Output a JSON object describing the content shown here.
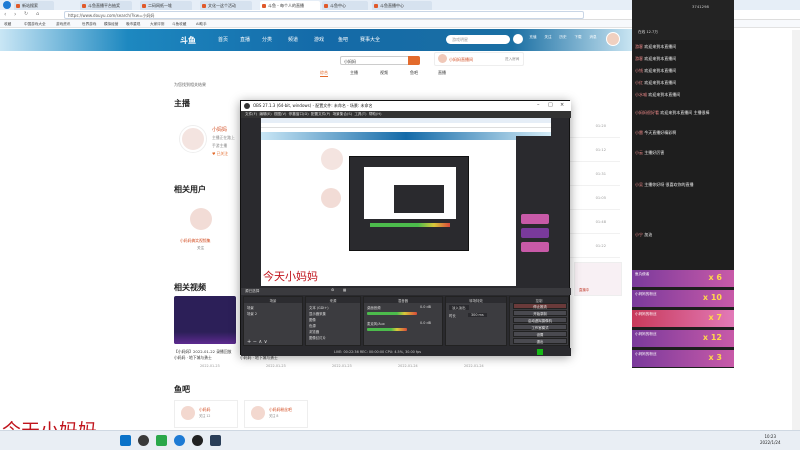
{
  "browser": {
    "tabs": [
      "新站搜索",
      "斗鱼直播平台抽奖",
      "二码网纸一堆",
      "文化—这个活动",
      "斗鱼 - 每个人的直播",
      "斗鱼中心",
      "斗鱼直播中心"
    ],
    "url": "https://www.douyu.com/search/?kw=小妈妈",
    "bookmarks": [
      "收藏",
      "中国游戏大全",
      "游戏资讯",
      "世界游戏",
      "模拟经营",
      "晚市重现",
      "大家评测",
      "斗鱼收藏",
      "AI助手"
    ]
  },
  "site": {
    "logo": "斗鱼",
    "nav": [
      "首页",
      "直播",
      "分类",
      "频道",
      "游戏",
      "鱼吧",
      "赛事大全"
    ],
    "search_placeholder": "游戏明星",
    "header_icons": [
      "充值",
      "关注",
      "历史",
      "下载",
      "消息"
    ],
    "query": "小妈妈",
    "search_tabs": [
      "综合",
      "主播",
      "视频",
      "鱼吧",
      "直播"
    ],
    "room_name": "小妈妈直播间",
    "room_enter": "进入房间",
    "breadcrumb": "为您找到相关结果",
    "sections": {
      "anchor": "主播",
      "users": "相关用户",
      "videos": "相关视频",
      "fish": "鱼吧"
    },
    "anchor": {
      "name": "小妈妈",
      "sub1": "主播正在路上",
      "sub2": "手游主播",
      "follow": "♥ 已关注"
    },
    "user": {
      "name": "小妈妈搞笑视频集",
      "follow": "关注"
    },
    "videos": [
      {
        "title": "【小妈妈】2022-01-22 录播回放",
        "meta": "小妈妈 · 地下城与勇士",
        "date": "2022-01-23"
      },
      {
        "title": "小妈妈勇士赛事",
        "meta": "小妈妈 · 地下城与勇士",
        "date": "2022-01-23"
      },
      {
        "title": "小妈妈直播精彩",
        "meta": "小妈妈 · 地下城与勇士",
        "date": "2022-01-23"
      },
      {
        "title": "小妈妈通关集锦",
        "meta": "小妈妈 · 地下城与勇士",
        "date": "2022-01-24"
      },
      {
        "title": "小妈妈直播回放",
        "meta": "小妈妈 · 地下城与勇士",
        "date": "2022-01-24"
      }
    ],
    "fish": [
      {
        "name": "小妈妈",
        "sub": "关注 12"
      },
      {
        "name": "小妈妈粉丝吧",
        "sub": "关注 8"
      }
    ],
    "side_times": [
      "01:20",
      "01:12",
      "01:31",
      "01:05",
      "01:48",
      "01:22"
    ],
    "right_cards": [
      "直播中",
      "直播中",
      "直播中",
      "直播中"
    ]
  },
  "obs": {
    "title": "OBS 27.1.3 (64-bit, windows) - 配置文件: 未命名 - 场景: 未命名",
    "menu": [
      "文件(F)",
      "编辑(E)",
      "视图(V)",
      "停靠窗口(D)",
      "配置文件(P)",
      "场景集合(S)",
      "工具(T)",
      "帮助(H)"
    ],
    "preview_watermark": "今天小妈妈",
    "status_bar": "源已选择",
    "docks": {
      "scenes": "场景",
      "sources": "来源",
      "mixer": "混音器",
      "transitions": "转场特效",
      "controls": "控制"
    },
    "scenes": [
      "场景",
      "场景 2"
    ],
    "sources": [
      "文本 (GDI+)",
      "显示器采集",
      "图像",
      "色源",
      "浏览器",
      "图像幻灯片"
    ],
    "mixer": [
      {
        "name": "桌面音频",
        "db": "0.0 dB",
        "level": 0.7
      },
      {
        "name": "麦克风/Aux",
        "db": "0.0 dB",
        "level": 0.55
      }
    ],
    "transition": {
      "type": "淡入淡出",
      "duration_label": "时长",
      "duration": "300 ms"
    },
    "controls": [
      "停止推流",
      "开始录制",
      "启动虚拟摄像机",
      "工作室模式",
      "设置",
      "退出"
    ],
    "status": "LIVE: 00:22:36  REC: 00:00:00  CPU: 4.5%, 30.00 fps"
  },
  "chat": {
    "viewers": "3741298",
    "stat": "在线 12.7万",
    "messages": [
      {
        "user": "游客",
        "text": "欢迎来到本直播间"
      },
      {
        "user": "游客",
        "text": "欢迎来到本直播间"
      },
      {
        "user": "小钱",
        "text": "欢迎来到本直播间"
      },
      {
        "user": "小红",
        "text": "欢迎来到本直播间"
      },
      {
        "user": "小水喵",
        "text": "欢迎来到本直播间"
      },
      {
        "user": "小妈妈很好看",
        "text": "欢迎来到本直播间 主播很棒"
      },
      {
        "user": "小雷",
        "text": "今天直播好精彩啊"
      },
      {
        "user": "小云",
        "text": "主播好厉害"
      },
      {
        "user": "小吴",
        "text": "主播你好呀 很喜欢你的直播"
      },
      {
        "user": "小宁",
        "text": "加油"
      }
    ],
    "gifts": [
      {
        "user": "鱼丸使者",
        "count": "x 6"
      },
      {
        "user": "小妈妈的粉丝",
        "count": "x 10"
      },
      {
        "user": "小妈妈的粉丝",
        "count": "x 7"
      },
      {
        "user": "小妈妈的粉丝",
        "count": "x 12"
      },
      {
        "user": "小妈妈的粉丝",
        "count": "x 3"
      }
    ]
  },
  "desktop_watermark": "今天小妈妈",
  "taskbar": {
    "time": "10:23",
    "date": "2022/1/24"
  }
}
